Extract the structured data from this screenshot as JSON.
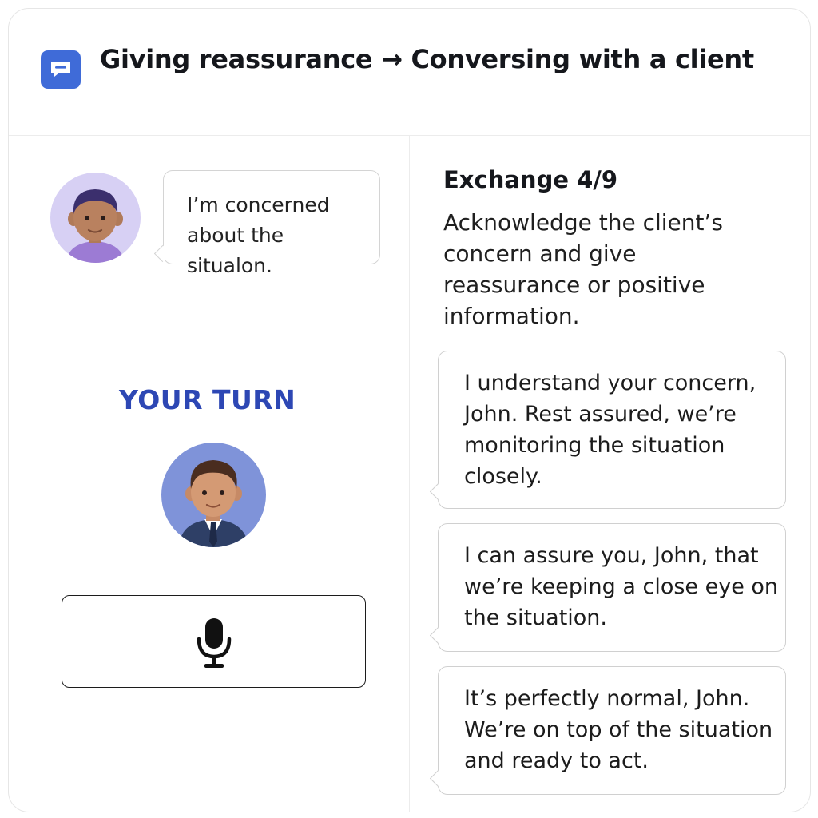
{
  "header": {
    "title": "Giving reassurance → Conversing with a client",
    "icon": "chat-bubble-icon",
    "icon_color": "#3f6bd8"
  },
  "client": {
    "avatar": "client-avatar",
    "message": "I’m concerned about the situalon."
  },
  "user": {
    "turn_label": "YOUR TURN",
    "avatar": "user-avatar",
    "mic_icon": "microphone-icon"
  },
  "exercise": {
    "exchange_label": "Exchange 4/9",
    "instruction": "Acknowledge the client’s concern and give reassurance or positive information.",
    "options": [
      "I understand your concern, John. Rest assured, we’re monitoring the situation closely.",
      "I can assure you, John, that we’re keeping a close eye on the situation.",
      "It’s perfectly normal, John. We’re on top of the situation and ready to act."
    ]
  },
  "colors": {
    "accent": "#2d47b4",
    "client_avatar_bg": "#d7d0f4",
    "user_avatar_bg": "#7f93d9"
  }
}
